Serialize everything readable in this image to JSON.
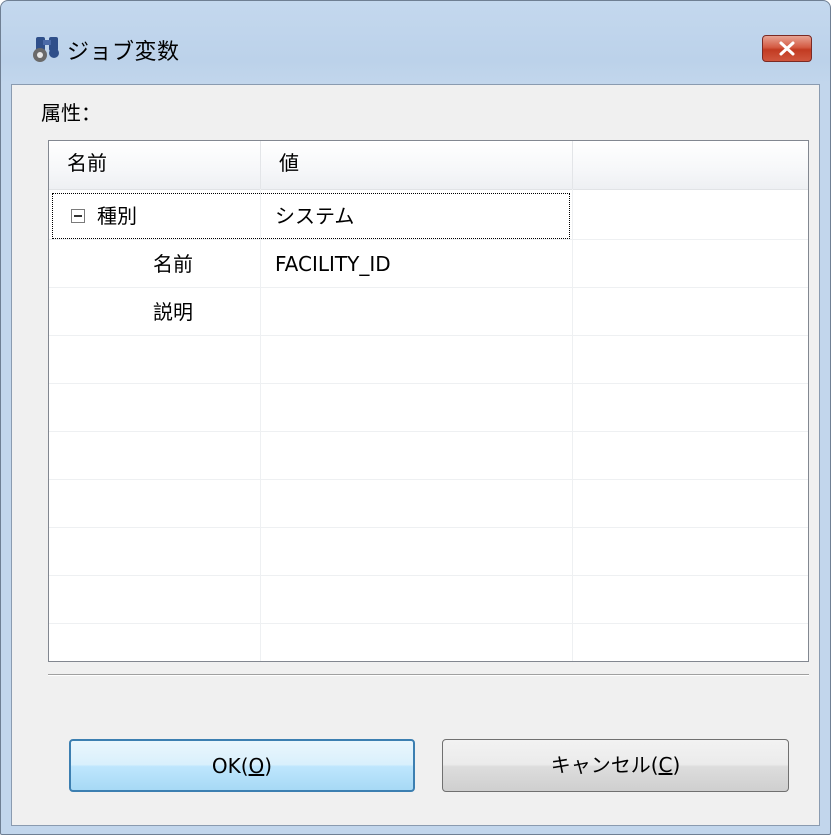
{
  "window": {
    "title": "ジョブ変数",
    "close_icon": "close-icon",
    "app_icon": "binoculars-gear-icon"
  },
  "attributes_label": "属性：",
  "table": {
    "columns": [
      "名前",
      "値",
      ""
    ],
    "rows": [
      {
        "name": "種別",
        "value": "システム",
        "expanded": true,
        "level": 0
      },
      {
        "name": "名前",
        "value": "FACILITY_ID",
        "level": 1
      },
      {
        "name": "説明",
        "value": "",
        "level": 1
      }
    ]
  },
  "buttons": {
    "ok": {
      "text": "OK(",
      "mnemonic": "O",
      "close": ")"
    },
    "cancel": {
      "text": "キャンセル(",
      "mnemonic": "C",
      "close": ")"
    }
  },
  "colors": {
    "titlebar": "#bcd2ea",
    "close_button": "#c23b22",
    "dialog_bg": "#f0f0f0",
    "ok_border": "#3c7fb1"
  }
}
